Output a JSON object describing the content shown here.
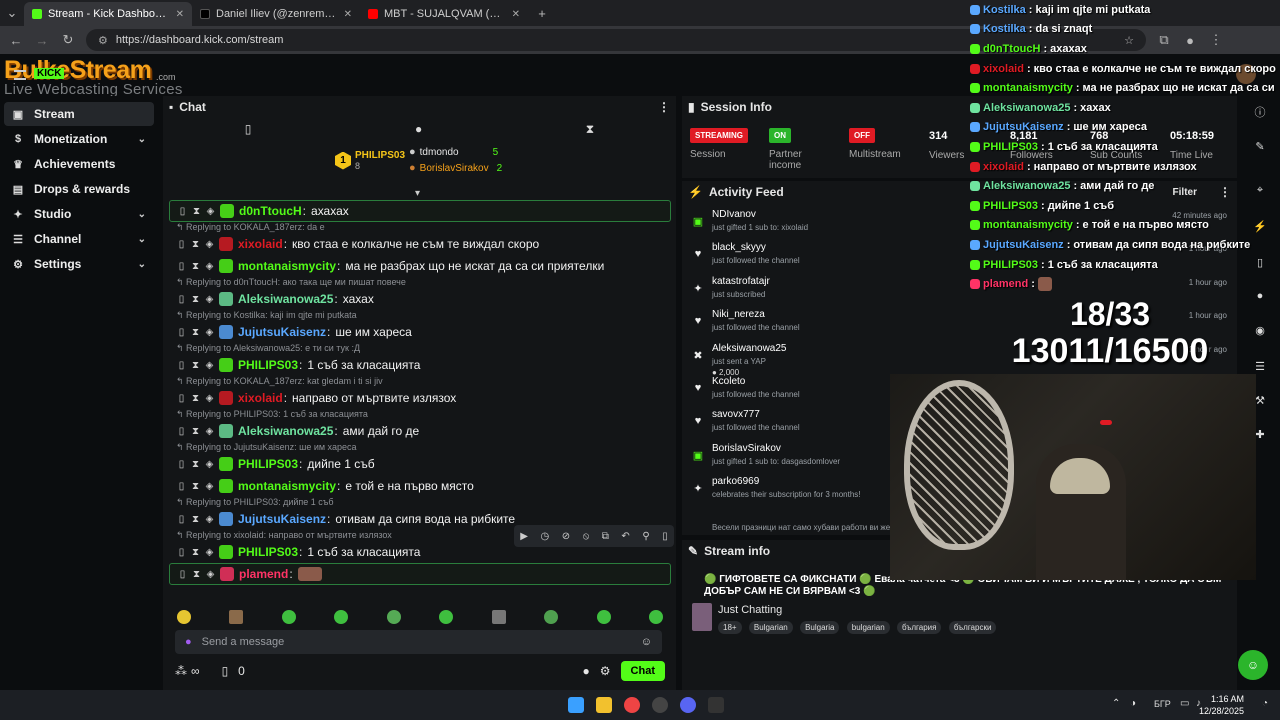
{
  "browser": {
    "tabs": [
      {
        "title": "Stream - Kick Dashboard",
        "color": "#53fc18",
        "active": true
      },
      {
        "title": "Daniel Iliev (@zenremasta) | Tik",
        "color": "#111111",
        "active": false
      },
      {
        "title": "MBT - SUJALQVAM (OFFICI...",
        "color": "#ff0000",
        "active": false
      }
    ],
    "new_tab": "+",
    "url": "https://dashboard.kick.com/stream"
  },
  "logo": {
    "title": "BulkeStream",
    "badge": "KICK",
    "subtitle": "Live Webcasting Services",
    "domain": ".com"
  },
  "sidebar": {
    "items": [
      {
        "label": "Stream",
        "icon": "video-icon",
        "glyph": "▣",
        "active": true,
        "chevron": false
      },
      {
        "label": "Monetization",
        "icon": "dollar-icon",
        "glyph": "$",
        "active": false,
        "chevron": true
      },
      {
        "label": "Achievements",
        "icon": "trophy-icon",
        "glyph": "♛",
        "active": false,
        "chevron": false
      },
      {
        "label": "Drops & rewards",
        "icon": "gift-icon",
        "glyph": "▤",
        "active": false,
        "chevron": false
      },
      {
        "label": "Studio",
        "icon": "studio-icon",
        "glyph": "✦",
        "active": false,
        "chevron": true
      },
      {
        "label": "Channel",
        "icon": "channel-icon",
        "glyph": "☰",
        "active": false,
        "chevron": true
      },
      {
        "label": "Settings",
        "icon": "gear-icon",
        "glyph": "⚙",
        "active": false,
        "chevron": true
      }
    ]
  },
  "chat": {
    "title": "Chat",
    "leaders": {
      "first": {
        "name": "PHILIPS03",
        "count": "8"
      },
      "second": {
        "name": "tdmondo",
        "count": "5"
      },
      "third": {
        "name": "BorislavSirakov",
        "count": "2"
      },
      "rank": "1"
    },
    "messages": [
      {
        "reply": "",
        "user": "d0nTtoucH",
        "color": "#53fc18",
        "text": "ахахах",
        "boxed": true
      },
      {
        "reply": "Replying to KOKALA_187erz: da e",
        "user": "xixolaid",
        "color": "#e01b24",
        "text": "кво стаа е колкалче не съм те виждал скоро",
        "boxed": false
      },
      {
        "reply": "",
        "user": "montanaismycity",
        "color": "#53fc18",
        "text": "ма не разбрах що не искат да са си приятелки",
        "boxed": false
      },
      {
        "reply": "Replying to d0nTtoucH: ако така ще ми пишат повече",
        "user": "Aleksiwanowa25",
        "color": "#6fe3a0",
        "text": "хахах",
        "boxed": false
      },
      {
        "reply": "Replying to Kostilka: kaji im qjte mi putkata",
        "user": "JujutsuKaisenz",
        "color": "#5aa8ff",
        "text": "ше им хареса",
        "boxed": false
      },
      {
        "reply": "Replying to Aleksiwanowa25: е ти си тук :Д",
        "user": "PHILIPS03",
        "color": "#53fc18",
        "text": "1 съб за класацията",
        "boxed": false
      },
      {
        "reply": "Replying to KOKALA_187erz: kat gledam i ti si jiv",
        "user": "xixolaid",
        "color": "#e01b24",
        "text": "направо от мъртвите излязох",
        "boxed": false
      },
      {
        "reply": "Replying to PHILIPS03: 1 съб за класацията",
        "user": "Aleksiwanowa25",
        "color": "#6fe3a0",
        "text": "ами дай го де",
        "boxed": false
      },
      {
        "reply": "Replying to JujutsuKaisenz: ше им хареса",
        "user": "PHILIPS03",
        "color": "#53fc18",
        "text": "дийпе 1 съб",
        "boxed": false
      },
      {
        "reply": "",
        "user": "montanaismycity",
        "color": "#53fc18",
        "text": "е той е на първо място",
        "boxed": false
      },
      {
        "reply": "Replying to PHILIPS03: дийпе 1 съб",
        "user": "JujutsuKaisenz",
        "color": "#5aa8ff",
        "text": "отивам да сипя вода на рибките",
        "boxed": false
      },
      {
        "reply": "Replying to xixolaid: направо от мъртвите излязох",
        "user": "PHILIPS03",
        "color": "#53fc18",
        "text": "1 съб за класацията",
        "boxed": false
      },
      {
        "reply": "",
        "user": "plamend",
        "color": "#ff3366",
        "text": "",
        "boxed": true
      }
    ],
    "input_placeholder": "Send a message",
    "footer": {
      "points": "∞",
      "count": "0",
      "chat_button": "Chat"
    }
  },
  "session": {
    "title": "Session Info",
    "stats": [
      {
        "badge": "STREAMING",
        "badge_color": "#e01b24",
        "label": "Session"
      },
      {
        "badge": "ON",
        "badge_color": "#2bb52b",
        "label": "Partner income"
      },
      {
        "badge": "OFF",
        "badge_color": "#e01b24",
        "label": "Multistream"
      },
      {
        "value": "314",
        "label": "Viewers"
      },
      {
        "value": "8,181",
        "label": "Followers"
      },
      {
        "value": "768",
        "label": "Sub Counts"
      },
      {
        "value": "05:18:59",
        "label": "Time Live"
      }
    ]
  },
  "activity": {
    "title": "Activity Feed",
    "filter": "Filter",
    "items": [
      {
        "icon": "gift-icon",
        "glyph": "▣",
        "name": "NDIvanov",
        "sub": "just gifted 1 sub to: xixolaid",
        "time": "42 minutes ago"
      },
      {
        "icon": "heart-icon",
        "glyph": "♥",
        "name": "black_skyyy",
        "sub": "just followed the channel",
        "time": "1 hour ago"
      },
      {
        "icon": "star-icon",
        "glyph": "✦",
        "name": "katastrofatajr",
        "sub": "just subscribed",
        "time": "1 hour ago"
      },
      {
        "icon": "heart-icon",
        "glyph": "♥",
        "name": "Niki_nereza",
        "sub": "just followed the channel",
        "time": "1 hour ago"
      },
      {
        "icon": "kick-icon",
        "glyph": "✖",
        "name": "Aleksiwanowa25",
        "sub": "just sent a YAP",
        "extra": "2,000",
        "time": "1 hour ago"
      },
      {
        "icon": "heart-icon",
        "glyph": "♥",
        "name": "Kcoleto",
        "sub": "just followed the channel",
        "time": ""
      },
      {
        "icon": "heart-icon",
        "glyph": "♥",
        "name": "savovx777",
        "sub": "just followed the channel",
        "time": ""
      },
      {
        "icon": "gift-icon",
        "glyph": "▣",
        "name": "BorislavSirakov",
        "sub": "just gifted 1 sub to: dasgasdomlover",
        "time": ""
      },
      {
        "icon": "star-icon",
        "glyph": "✦",
        "name": "parko6969",
        "sub": "celebrates their subscription for 3 months!",
        "time": ""
      }
    ],
    "trailing": "Весели празници нат само хубави работи ви же..."
  },
  "stream_info": {
    "title": "Stream info",
    "headline": "🟢 ГИФТОВЕТЕ СА ФИКСНАТИ 🟢 Евала чатчета <3 🟢 ОБИЧАМ ВИ И МЪРТИТЕ ДАЖЕ , ТОЛКО ДА СЪМ ДОБЪР САМ НЕ СИ ВЯРВАМ <3 🟢",
    "category": "Just Chatting",
    "tags": [
      "18+",
      "Bulgarian",
      "Bulgaria",
      "bulgarian",
      "българия",
      "български"
    ]
  },
  "overlay": {
    "lines": [
      {
        "user": "Kostilka",
        "color": "#5aa8ff",
        "text": "kaji im qjte mi putkata"
      },
      {
        "user": "Kostilka",
        "color": "#5aa8ff",
        "text": "da si znaqt"
      },
      {
        "user": "d0nTtoucH",
        "color": "#53fc18",
        "text": "ахахах"
      },
      {
        "user": "xixolaid",
        "color": "#e01b24",
        "text": "кво стаа е колкалче не съм те виждал скоро"
      },
      {
        "user": "montanaismycity",
        "color": "#53fc18",
        "text": "ма не разбрах що не искат да са си"
      },
      {
        "user": "Aleksiwanowa25",
        "color": "#6fe3a0",
        "text": "хахах"
      },
      {
        "user": "JujutsuKaisenz",
        "color": "#5aa8ff",
        "text": "ше им хареса"
      },
      {
        "user": "PHILIPS03",
        "color": "#53fc18",
        "text": "1 съб за класацията"
      },
      {
        "user": "xixolaid",
        "color": "#e01b24",
        "text": "направо от мъртвите излязох"
      },
      {
        "user": "Aleksiwanowa25",
        "color": "#6fe3a0",
        "text": "ами дай го де"
      },
      {
        "user": "PHILIPS03",
        "color": "#53fc18",
        "text": "дийпе 1 съб"
      },
      {
        "user": "montanaismycity",
        "color": "#53fc18",
        "text": "е той е на първо място"
      },
      {
        "user": "JujutsuKaisenz",
        "color": "#5aa8ff",
        "text": "отивам да сипя вода на рибките"
      },
      {
        "user": "PHILIPS03",
        "color": "#53fc18",
        "text": "1 съб за класацията"
      },
      {
        "user": "plamend",
        "color": "#ff3366",
        "text": ""
      }
    ],
    "counter_top": "18/33",
    "counter_bottom": "13011/16500"
  },
  "taskbar": {
    "lang": "БГР",
    "time": "1:16 AM",
    "date": "12/28/2025"
  }
}
